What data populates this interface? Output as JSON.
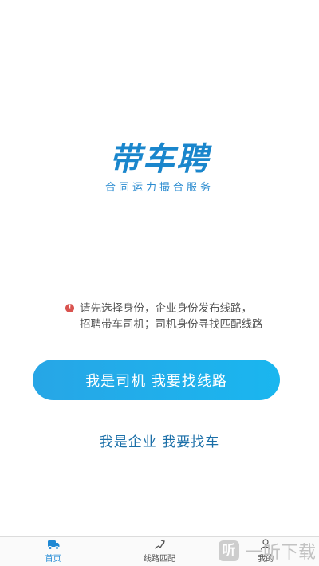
{
  "logo": {
    "title": "带车聘",
    "subtitle": "合同运力撮合服务"
  },
  "notice": {
    "line1": "请先选择身份，企业身份发布线路，",
    "line2": "招聘带车司机；司机身份寻找匹配线路"
  },
  "actions": {
    "driver_label": "我是司机  我要找线路",
    "company_label": "我是企业  我要找车"
  },
  "tabbar": {
    "items": [
      {
        "label": "首页",
        "icon": "truck-icon",
        "active": true
      },
      {
        "label": "线路匹配",
        "icon": "route-icon",
        "active": false
      },
      {
        "label": "我的",
        "icon": "person-icon",
        "active": false
      }
    ]
  },
  "watermark": {
    "badge": "听",
    "text": "一听下载"
  },
  "colors": {
    "brand": "#1a86cc",
    "button": "#1ab6ef",
    "link": "#1b6fa8",
    "alert": "#d9534f"
  }
}
